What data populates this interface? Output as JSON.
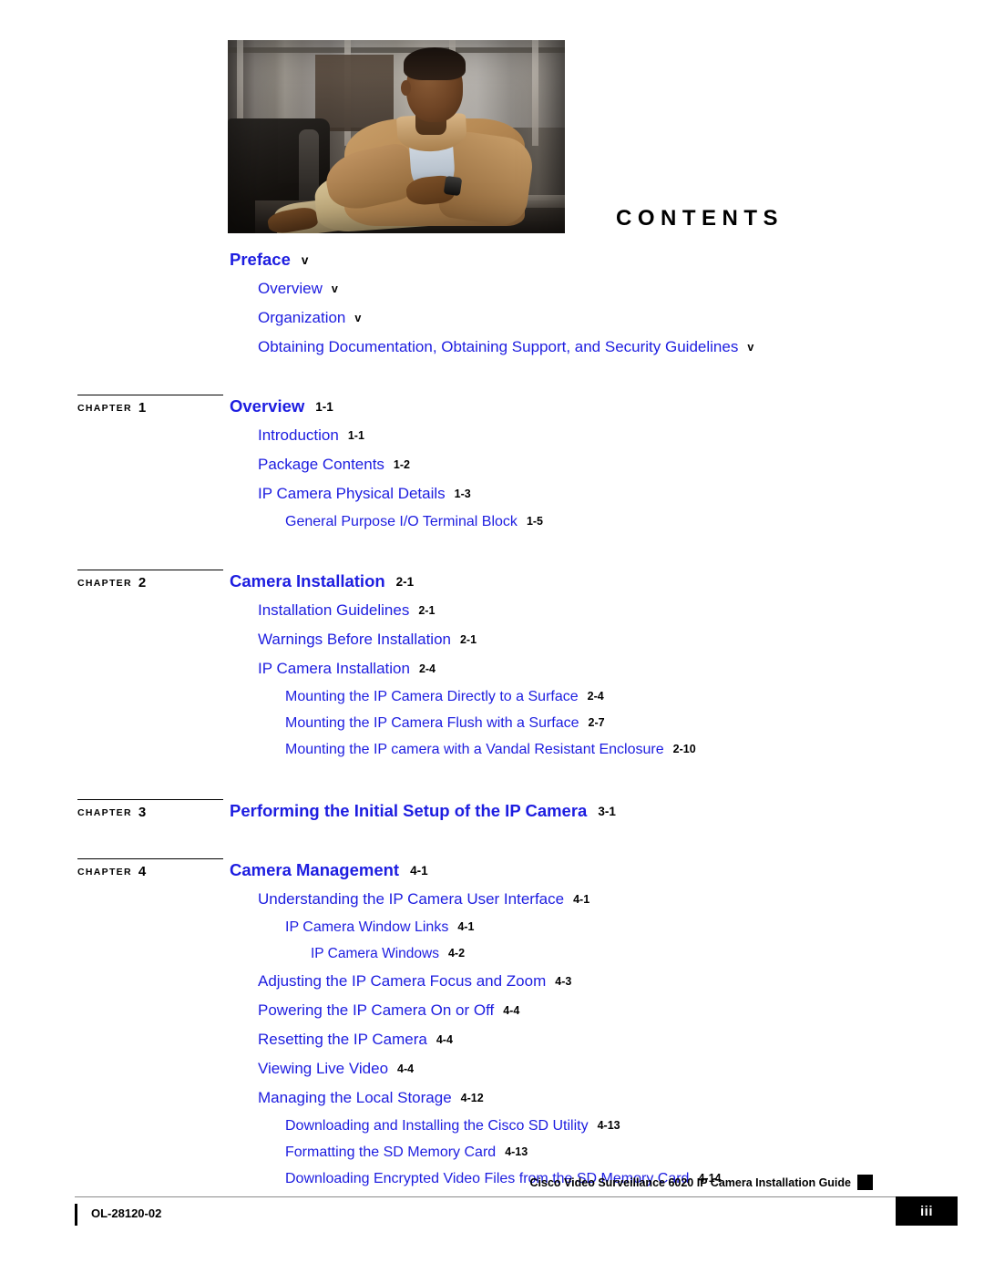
{
  "page": {
    "heading": "CONTENTS",
    "cover_photo_alt": "seated-man-in-tan-jacket"
  },
  "chapter_label_word": "CHAPTER",
  "toc": [
    {
      "chapter_number": "",
      "entries": [
        {
          "level": 1,
          "title": "Preface",
          "page": "v"
        },
        {
          "level": 2,
          "title": "Overview",
          "page": "v"
        },
        {
          "level": 2,
          "title": "Organization",
          "page": "v"
        },
        {
          "level": 2,
          "title": "Obtaining Documentation, Obtaining Support, and Security Guidelines",
          "page": "v"
        }
      ]
    },
    {
      "chapter_number": "1",
      "entries": [
        {
          "level": 1,
          "title": "Overview",
          "page": "1-1"
        },
        {
          "level": 2,
          "title": "Introduction",
          "page": "1-1"
        },
        {
          "level": 2,
          "title": "Package Contents",
          "page": "1-2"
        },
        {
          "level": 2,
          "title": "IP Camera Physical Details",
          "page": "1-3"
        },
        {
          "level": 3,
          "title": "General Purpose I/O Terminal Block",
          "page": "1-5"
        }
      ]
    },
    {
      "chapter_number": "2",
      "entries": [
        {
          "level": 1,
          "title": "Camera Installation",
          "page": "2-1"
        },
        {
          "level": 2,
          "title": "Installation Guidelines",
          "page": "2-1"
        },
        {
          "level": 2,
          "title": "Warnings Before Installation",
          "page": "2-1"
        },
        {
          "level": 2,
          "title": "IP Camera Installation",
          "page": "2-4"
        },
        {
          "level": 3,
          "title": "Mounting the IP Camera Directly to a Surface",
          "page": "2-4"
        },
        {
          "level": 3,
          "title": "Mounting the IP Camera Flush with a Surface",
          "page": "2-7"
        },
        {
          "level": 3,
          "title": "Mounting the IP camera with a Vandal Resistant Enclosure",
          "page": "2-10"
        }
      ]
    },
    {
      "chapter_number": "3",
      "entries": [
        {
          "level": 1,
          "title": "Performing the Initial Setup of the IP Camera",
          "page": "3-1"
        }
      ]
    },
    {
      "chapter_number": "4",
      "entries": [
        {
          "level": 1,
          "title": "Camera Management",
          "page": "4-1"
        },
        {
          "level": 2,
          "title": "Understanding the IP Camera User Interface",
          "page": "4-1"
        },
        {
          "level": 3,
          "title": "IP Camera Window Links",
          "page": "4-1"
        },
        {
          "level": 4,
          "title": "IP Camera Windows",
          "page": "4-2"
        },
        {
          "level": 2,
          "title": "Adjusting the IP Camera Focus and Zoom",
          "page": "4-3"
        },
        {
          "level": 2,
          "title": "Powering the IP Camera On or Off",
          "page": "4-4"
        },
        {
          "level": 2,
          "title": "Resetting the IP Camera",
          "page": "4-4"
        },
        {
          "level": 2,
          "title": "Viewing Live Video",
          "page": "4-4"
        },
        {
          "level": 2,
          "title": "Managing the Local Storage",
          "page": "4-12"
        },
        {
          "level": 3,
          "title": "Downloading and Installing the Cisco SD Utility",
          "page": "4-13"
        },
        {
          "level": 3,
          "title": "Formatting the SD Memory Card",
          "page": "4-13"
        },
        {
          "level": 3,
          "title": "Downloading Encrypted Video Files from the SD Memory Card",
          "page": "4-14"
        }
      ]
    }
  ],
  "footer": {
    "guide_title": "Cisco Video Surveillance 6020 IP Camera Installation Guide",
    "document_id": "OL-28120-02",
    "page_number": "iii"
  },
  "colors": {
    "link_blue": "#1d1de0",
    "text_black": "#000000",
    "footer_rule": "#8a8a8a"
  }
}
